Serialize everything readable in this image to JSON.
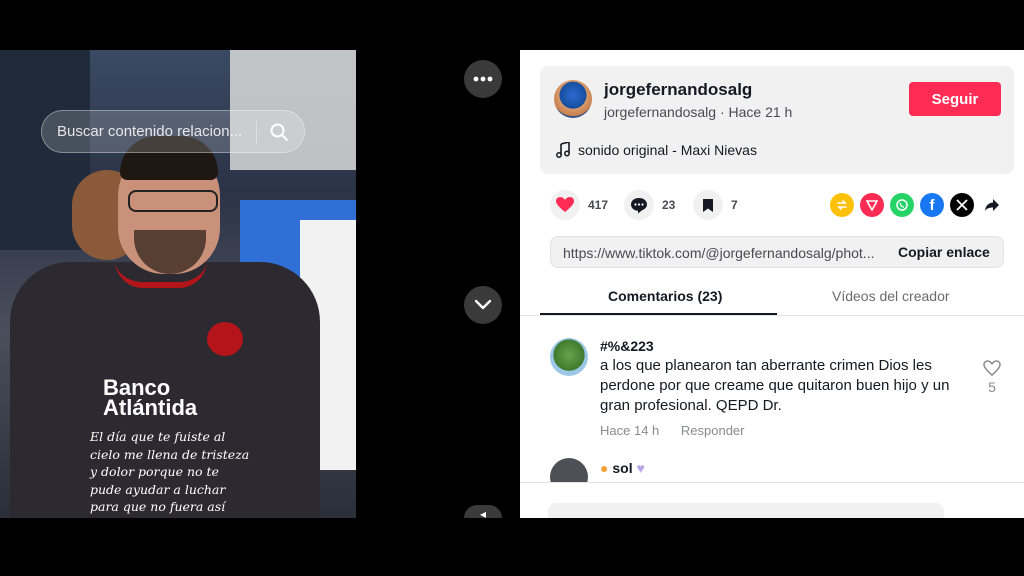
{
  "media": {
    "search_placeholder": "Buscar contenido relacion...",
    "sponsor_line1": "Banco",
    "sponsor_line2": "Atlántida",
    "caption": "El día que te fuiste al cielo me llena de tristeza y dolor porque no te pude ayudar a luchar para que no fuera así hijo amado. Te extraño mucho amor"
  },
  "creator": {
    "username": "jorgefernandosalg",
    "subline": "jorgefernandosalg · Hace 21 h",
    "follow_label": "Seguir",
    "sound": "sonido original - Maxi Nievas"
  },
  "actions": {
    "likes": "417",
    "comments": "23",
    "saves": "7"
  },
  "share_icons": [
    "repost-icon",
    "send-icon",
    "whatsapp-icon",
    "facebook-icon",
    "x-icon",
    "forward-icon"
  ],
  "link": {
    "url": "https://www.tiktok.com/@jorgefernandosalg/phot...",
    "copy_label": "Copiar enlace"
  },
  "tabs": {
    "comments": "Comentarios (23)",
    "creator_videos": "Vídeos del creador"
  },
  "comments": [
    {
      "user": "#%&223",
      "text": "a los que planearon tan aberrante crimen Dios les perdone por que creame que quitaron buen hijo y un gran profesional. QEPD Dr.",
      "time": "Hace 14 h",
      "reply": "Responder",
      "likes": "5"
    },
    {
      "user": "sol"
    }
  ],
  "colors": {
    "accent": "#fe2c55",
    "text": "#161823",
    "muted": "#8a8b91"
  }
}
